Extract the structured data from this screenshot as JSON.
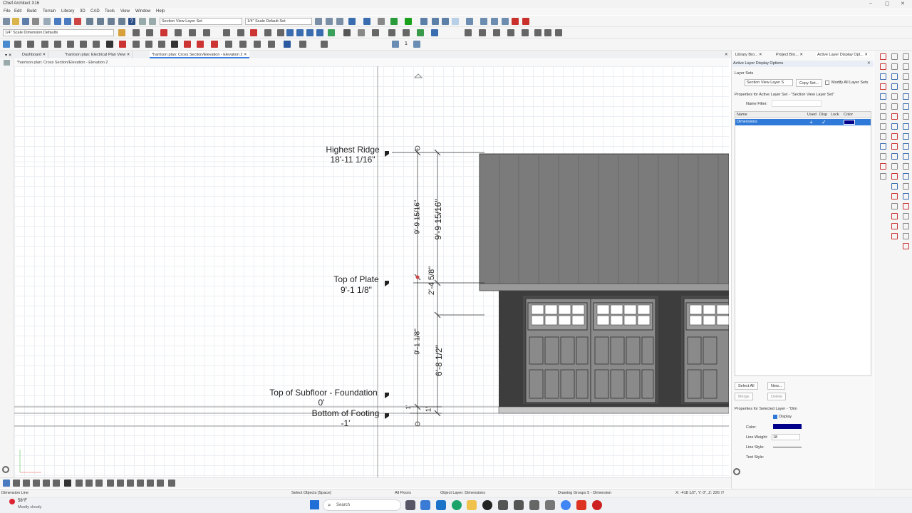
{
  "app": {
    "title": "Chief Architect X16"
  },
  "menu": [
    "File",
    "Edit",
    "Build",
    "Terrain",
    "Library",
    "3D",
    "CAD",
    "Tools",
    "View",
    "Window",
    "Help"
  ],
  "toolbar": {
    "layer_set": "Section View Layer Set",
    "scale_set": "1/4\" Scale Default Set",
    "dimension_defaults": "1/4\" Scale Dimension Defaults",
    "floor_number": "1"
  },
  "tabs": [
    {
      "label": "Dashboard"
    },
    {
      "label": "*harrison plan: Electrical Plan View"
    },
    {
      "label": "*harrison plan: Cross Section/Elevation - Elevation 2"
    }
  ],
  "view_title": "*harrison plan: Cross Section/Elevation - Elevation 2",
  "drawing": {
    "markers": [
      {
        "name": "Highest Ridge",
        "value": "18'-11 1/16\""
      },
      {
        "name": "Top of Plate",
        "value": "9'-1 1/8\""
      },
      {
        "name": "Top of Subfloor - Foundation",
        "value": "0'"
      },
      {
        "name": "Bottom of Footing",
        "value": "-1'"
      }
    ],
    "dimensions": {
      "upper_left": "9'-9 15/16\"",
      "upper_right": "9'-9 15/16\"",
      "mid_right": "2'-4 5/8\"",
      "lower_left": "9'-1 1/8\"",
      "lower_right": "6'-8 1/2\"",
      "footing_left": "1'",
      "footing_right": "1'"
    }
  },
  "panel": {
    "tabs": [
      "Library Bro...",
      "Project Bro...",
      "Active Layer Display Opt..."
    ],
    "title": "Active Layer Display Options",
    "layer_sets_label": "Layer Sets",
    "layer_set_value": "Section View Layer S",
    "copy_set": "Copy Set...",
    "modify_all": "Modify All Layer Sets",
    "properties_label": "Properties for Active Layer Set - \"Section View Layer Set\"",
    "name_filter_label": "Name Filter:",
    "columns": [
      "Name",
      "Used",
      "Disp",
      "Lock",
      "Color"
    ],
    "rows": [
      {
        "name": "Dimensions",
        "used": "+",
        "disp": "✓",
        "lock": "",
        "color": "#00008b"
      }
    ],
    "buttons": {
      "select_all": "Select All",
      "new": "New...",
      "merge": "Merge",
      "delete": "Delete"
    },
    "selected_props_label": "Properties for Selected Layer - \"Dim",
    "display_label": "Display",
    "color_label": "Color:",
    "line_weight_label": "Line Weight:",
    "line_weight_value": "18",
    "line_style_label": "Line Style:",
    "text_style_label": "Text Style:"
  },
  "status": {
    "left": "Dimension Line",
    "mode": "Select Objects [Space]",
    "floors": "All Floors",
    "layer": "Object Layer: Dimensions",
    "group": "Drawing Groups 5 - Dimension",
    "coords": "X: -418 1/2\", Y: 0\", Z: 226 7/"
  },
  "taskbar": {
    "weather_temp": "58°F",
    "weather_desc": "Mostly cloudy",
    "search_placeholder": "Search"
  }
}
